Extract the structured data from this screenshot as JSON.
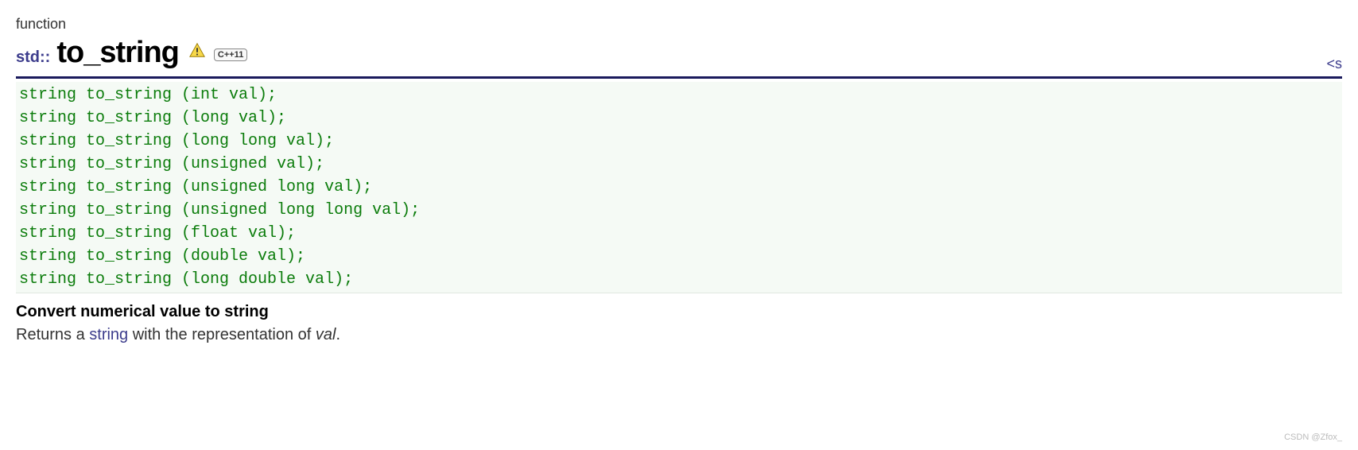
{
  "category": "function",
  "namespace": "std::",
  "function_name": "to_string",
  "cpp_badge": "C++11",
  "header_hint": "<s",
  "signatures": [
    "string to_string (int val);",
    "string to_string (long val);",
    "string to_string (long long val);",
    "string to_string (unsigned val);",
    "string to_string (unsigned long val);",
    "string to_string (unsigned long long val);",
    "string to_string (float val);",
    "string to_string (double val);",
    "string to_string (long double val);"
  ],
  "desc_title": "Convert numerical value to string",
  "desc_prefix": "Returns a ",
  "desc_link": "string",
  "desc_mid": " with the representation of ",
  "desc_ital": "val",
  "desc_suffix": ".",
  "watermark": "CSDN @Zfox_"
}
